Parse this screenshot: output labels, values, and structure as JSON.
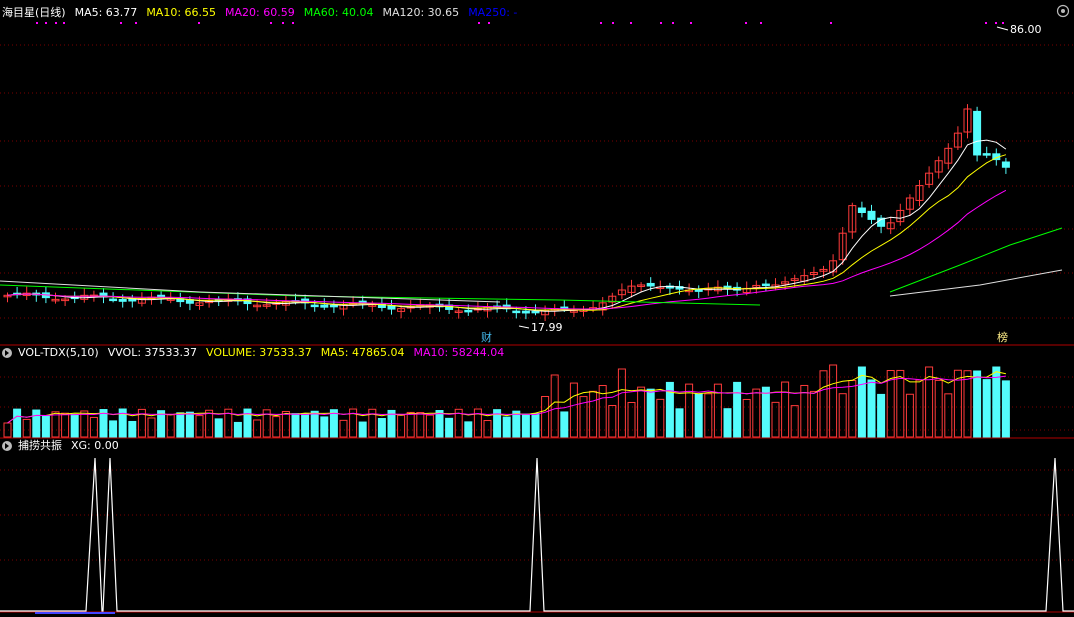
{
  "panels": {
    "main": {
      "title": "海目星(日线)",
      "indicators": [
        {
          "label": "MA5: 63.77",
          "color": "#ffffff"
        },
        {
          "label": "MA10: 66.55",
          "color": "#ffff00"
        },
        {
          "label": "MA20: 60.59",
          "color": "#ff00ff"
        },
        {
          "label": "MA60: 40.04",
          "color": "#00ff00"
        },
        {
          "label": "MA120: 30.65",
          "color": "#e0e0e0"
        },
        {
          "label": "MA250: -",
          "color": "#0000ff"
        }
      ],
      "high_label": "86.00",
      "low_label": "17.99",
      "markers": [
        {
          "text": "财",
          "color": "#44bbee"
        },
        {
          "text": "榜",
          "color": "#ffee88"
        }
      ]
    },
    "volume": {
      "title": "VOL-TDX(5,10)",
      "indicators": [
        {
          "label": "VVOL: 37533.37",
          "color": "#ffffff"
        },
        {
          "label": "VOLUME: 37533.37",
          "color": "#ffff00"
        },
        {
          "label": "MA5: 47865.04",
          "color": "#ffff00"
        },
        {
          "label": "MA10: 58244.04",
          "color": "#ff00ff"
        }
      ]
    },
    "indicator": {
      "title": "捕捞共振",
      "indicators": [
        {
          "label": "XG: 0.00",
          "color": "#ffffff"
        }
      ]
    }
  },
  "colors": {
    "background": "#000000",
    "up": "#ff3b3b",
    "down": "#54fcfc",
    "grid": "#7a0000",
    "separator": "#b00000",
    "dots": "#ff00ff"
  }
}
